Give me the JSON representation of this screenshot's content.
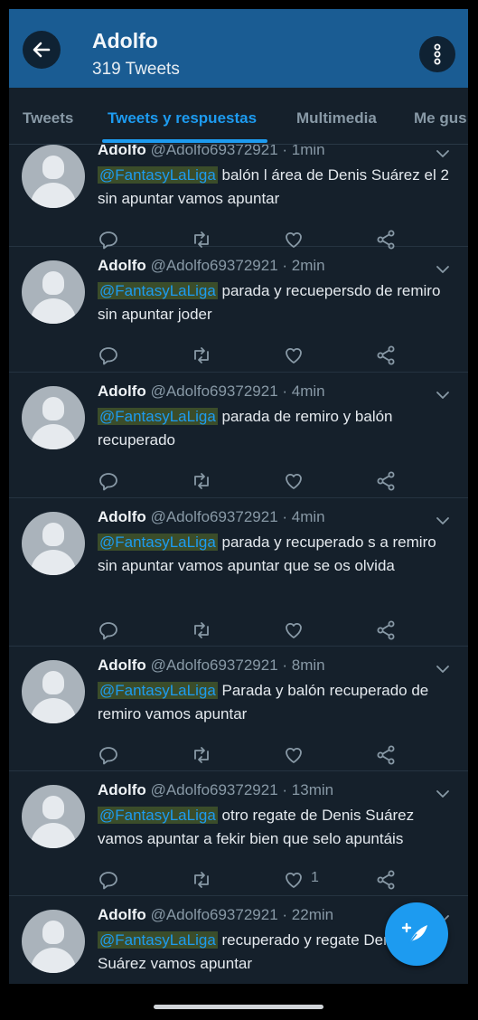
{
  "header": {
    "title": "Adolfo",
    "subtitle": "319 Tweets",
    "back_icon": "arrow-left-icon",
    "more_icon": "vertical-dots-icon",
    "background": "#1a5c93"
  },
  "tabs": [
    {
      "label": "Tweets",
      "active": false
    },
    {
      "label": "Tweets y respuestas",
      "active": true
    },
    {
      "label": "Multimedia",
      "active": false
    },
    {
      "label": "Me gus",
      "active": false
    }
  ],
  "tweets": [
    {
      "name": "Adolfo",
      "handle": "@Adolfo69372921",
      "time": "· 1min",
      "mention": "@FantasyLaLiga",
      "text": "balón l área de Denis Suárez el 2 sin apuntar vamos apuntar",
      "likes": ""
    },
    {
      "name": "Adolfo",
      "handle": "@Adolfo69372921",
      "time": "· 2min",
      "mention": "@FantasyLaLiga",
      "text": "parada y recuepersdo de remiro sin apuntar joder",
      "likes": ""
    },
    {
      "name": "Adolfo",
      "handle": "@Adolfo69372921",
      "time": "· 4min",
      "mention": "@FantasyLaLiga",
      "text": "parada de remiro y balón recuperado",
      "likes": ""
    },
    {
      "name": "Adolfo",
      "handle": "@Adolfo69372921",
      "time": "· 4min",
      "mention": "@FantasyLaLiga",
      "text": "parada y recuperado s a remiro sin apuntar vamos apuntar que se os olvida",
      "likes": ""
    },
    {
      "name": "Adolfo",
      "handle": "@Adolfo69372921",
      "time": "· 8min",
      "mention": "@FantasyLaLiga",
      "text": "Parada y balón recuperado de remiro vamos apuntar",
      "likes": ""
    },
    {
      "name": "Adolfo",
      "handle": "@Adolfo69372921",
      "time": "· 13min",
      "mention": "@FantasyLaLiga",
      "text": "otro regate de Denis Suárez vamos apuntar a fekir bien que selo apuntáis",
      "likes": "1"
    },
    {
      "name": "Adolfo",
      "handle": "@Adolfo69372921",
      "time": "· 22min",
      "mention": "@FantasyLaLiga",
      "text": "recuperado y regate Denis Suárez vamos apuntar",
      "likes": ""
    }
  ],
  "icons": {
    "reply": "reply-icon",
    "retweet": "retweet-icon",
    "like": "heart-icon",
    "share": "share-icon",
    "caret": "chevron-down-icon",
    "compose": "compose-tweet-icon"
  },
  "colors": {
    "accent": "#1d9bf0",
    "background": "#15202b",
    "mention_highlight": "#3b4d2a"
  }
}
